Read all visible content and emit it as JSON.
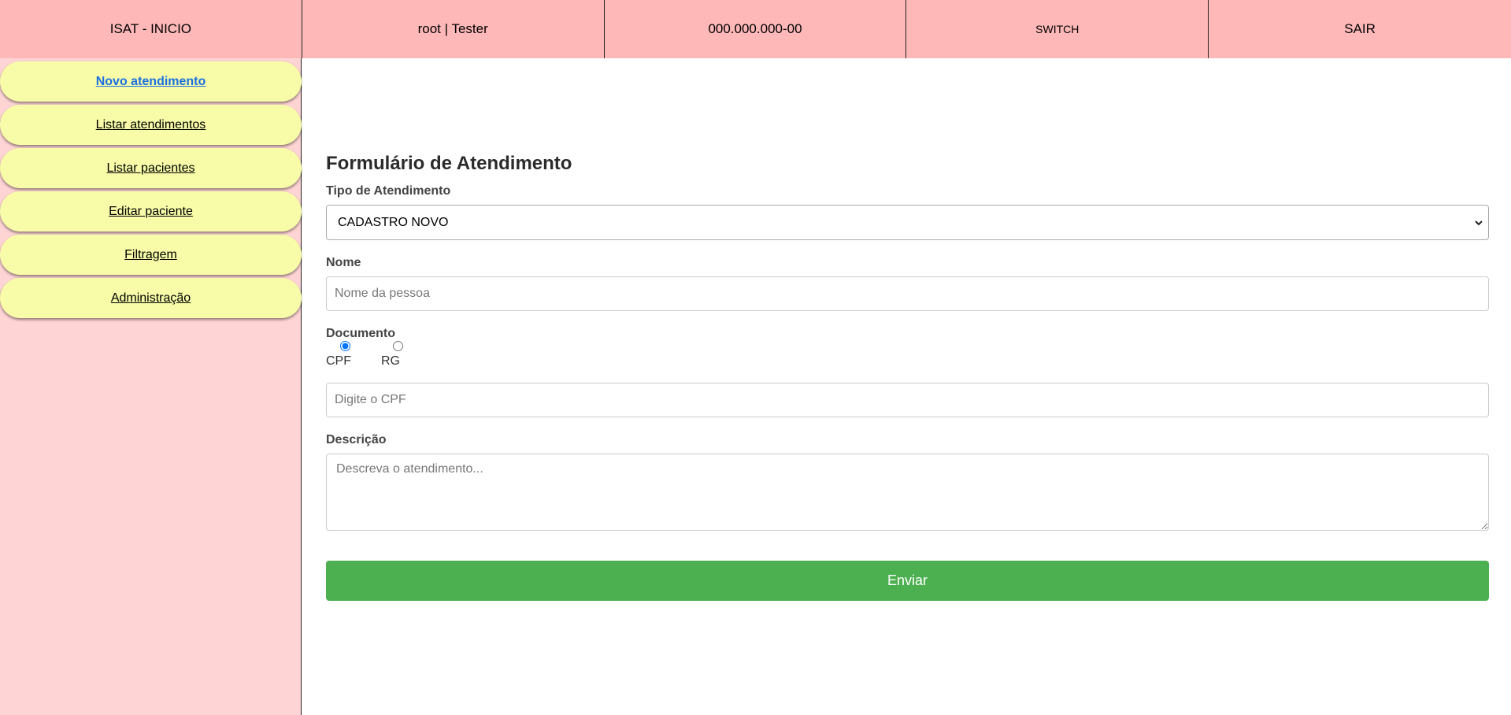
{
  "topbar": {
    "home": "ISAT - INICIO",
    "user": "root | Tester",
    "document": "000.000.000-00",
    "switch": "SWITCH",
    "logout": "SAIR"
  },
  "sidebar": {
    "items": [
      {
        "label": "Novo atendimento"
      },
      {
        "label": "Listar atendimentos"
      },
      {
        "label": "Listar pacientes"
      },
      {
        "label": "Editar paciente"
      },
      {
        "label": "Filtragem"
      },
      {
        "label": "Administração"
      }
    ]
  },
  "form": {
    "title": "Formulário de Atendimento",
    "tipo_label": "Tipo de Atendimento",
    "tipo_value": "CADASTRO NOVO",
    "nome_label": "Nome",
    "nome_placeholder": "Nome da pessoa",
    "documento_label": "Documento",
    "radio_cpf": "CPF",
    "radio_rg": "RG",
    "documento_placeholder": "Digite o CPF",
    "descricao_label": "Descrição",
    "descricao_placeholder": "Descreva o atendimento...",
    "submit": "Enviar"
  },
  "colors": {
    "topbar_bg": "#ffb8b8",
    "sidebar_bg": "#ffd4d4",
    "sidebar_item_bg": "#f8fca8",
    "active_link": "#1a6fe0",
    "submit_bg": "#4caf50"
  }
}
